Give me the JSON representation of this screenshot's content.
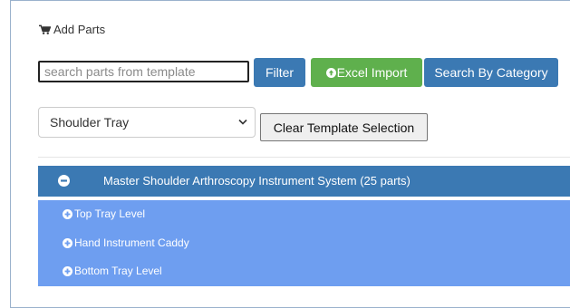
{
  "header": {
    "title": "Add Parts",
    "icon": "shopping-cart-icon"
  },
  "search": {
    "placeholder": "search parts from template",
    "value": ""
  },
  "buttons": {
    "filter": "Filter",
    "excel_import": "Excel Import",
    "search_by_category": "Search By Category",
    "clear_template": "Clear Template Selection"
  },
  "template_select": {
    "selected": "Shoulder Tray"
  },
  "master": {
    "label": "Master Shoulder Arthroscopy Instrument System (25 parts)",
    "icon": "minus-circle-icon"
  },
  "levels": [
    {
      "label": "Top Tray Level",
      "icon": "plus-circle-icon"
    },
    {
      "label": "Hand Instrument Caddy",
      "icon": "plus-circle-icon"
    },
    {
      "label": "Bottom Tray Level",
      "icon": "plus-circle-icon"
    }
  ],
  "colors": {
    "primary_blue": "#3b79b3",
    "success_green": "#5fb04d",
    "level_blue": "#6e9ef0"
  }
}
